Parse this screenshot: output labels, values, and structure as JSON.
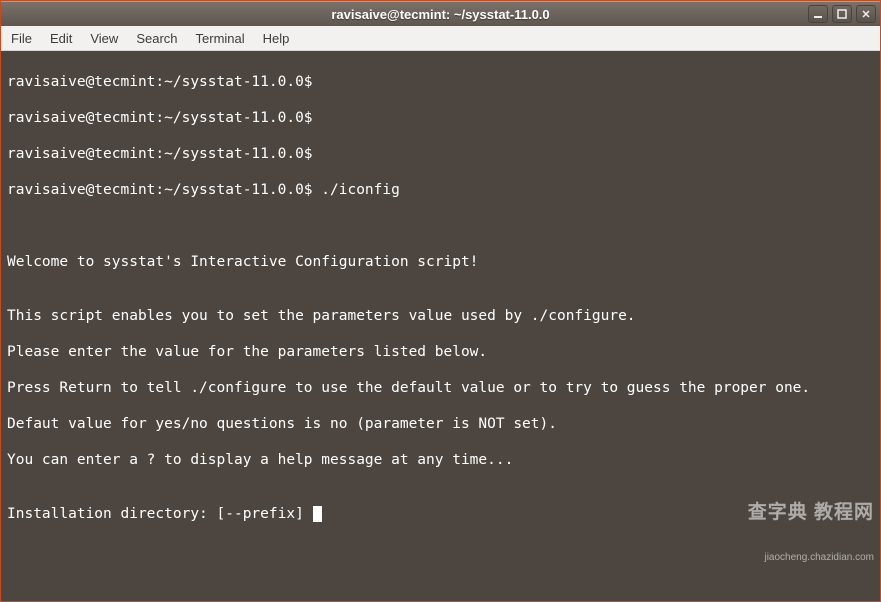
{
  "window": {
    "title": "ravisaive@tecmint: ~/sysstat-11.0.0"
  },
  "menu": {
    "file": "File",
    "edit": "Edit",
    "view": "View",
    "search": "Search",
    "terminal": "Terminal",
    "help": "Help"
  },
  "terminal": {
    "prompt": "ravisaive@tecmint:~/sysstat-11.0.0$",
    "command": " ./iconfig",
    "lines": {
      "l0": "ravisaive@tecmint:~/sysstat-11.0.0$",
      "l1": "ravisaive@tecmint:~/sysstat-11.0.0$",
      "l2": "ravisaive@tecmint:~/sysstat-11.0.0$",
      "l3": "ravisaive@tecmint:~/sysstat-11.0.0$ ./iconfig",
      "l4": "",
      "l5": "",
      "l6": "Welcome to sysstat's Interactive Configuration script!",
      "l7": "",
      "l8": "This script enables you to set the parameters value used by ./configure.",
      "l9": "Please enter the value for the parameters listed below.",
      "l10": "Press Return to tell ./configure to use the default value or to try to guess the proper one.",
      "l11": "Defaut value for yes/no questions is no (parameter is NOT set).",
      "l12": "You can enter a ? to display a help message at any time...",
      "l13": "",
      "l14": "Installation directory: [--prefix] "
    }
  },
  "watermark": {
    "line1": "查字典 教程网",
    "line2": "jiaocheng.chazidian.com"
  }
}
